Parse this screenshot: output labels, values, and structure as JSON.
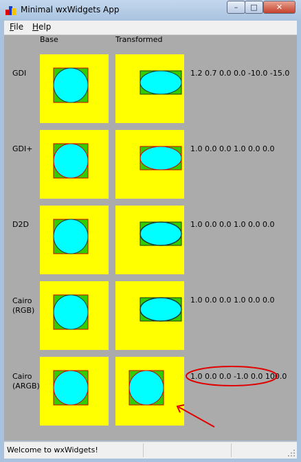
{
  "window": {
    "title": "Minimal wxWidgets App",
    "minimize_symbol": "–",
    "maximize_symbol": "□",
    "close_symbol": "✕"
  },
  "menu": {
    "file_accel": "F",
    "file_rest": "ile",
    "help_accel": "H",
    "help_rest": "elp"
  },
  "headers": {
    "base": "Base",
    "transformed": "Transformed"
  },
  "rows": [
    {
      "label": "GDI",
      "matrix": "1.2 0.7 0.0 0.0 -10.0 -15.0"
    },
    {
      "label": "GDI+",
      "matrix": "1.0 0.0 0.0 1.0 0.0 0.0"
    },
    {
      "label": "D2D",
      "matrix": "1.0 0.0 0.0 1.0 0.0 0.0"
    },
    {
      "label": "Cairo\n(RGB)",
      "matrix": "1.0 0.0 0.0 1.0 0.0 0.0"
    },
    {
      "label": "Cairo\n(ARGB)",
      "matrix": "1.0 0.0 0.0 -1.0 0.0 100.0"
    }
  ],
  "status": {
    "text": "Welcome to wxWidgets!"
  },
  "colors": {
    "panel_bg": "#ffff00",
    "rect_fill": "#33cc00",
    "rect_stroke": "#cc0000",
    "ellipse_fill": "#00ffff",
    "annotation": "#e00000",
    "content_bg": "#ababab"
  }
}
